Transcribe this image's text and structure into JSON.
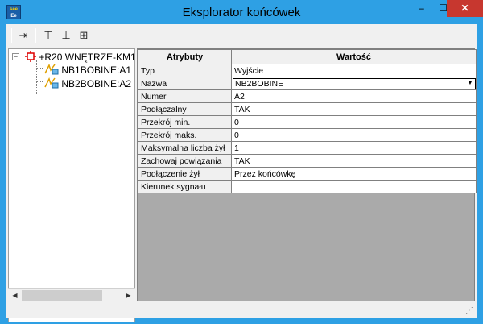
{
  "window": {
    "title": "Eksplorator końcówek",
    "icon": "app-icon",
    "icon_text_top": "see",
    "icon_text_bottom": "Ee",
    "controls": {
      "minimize": "‒",
      "maximize": "☐",
      "close": "✕"
    }
  },
  "toolbar": {
    "buttons": [
      {
        "name": "terminal-icon",
        "glyph": "⇥"
      },
      {
        "name": "connector-a-icon",
        "glyph": "⊤"
      },
      {
        "name": "connector-b-icon",
        "glyph": "⊥"
      },
      {
        "name": "connector-group-icon",
        "glyph": "⊞"
      }
    ]
  },
  "tree": {
    "root": {
      "label": "+R20 WNĘTRZE-KM1",
      "icon": "component-icon",
      "expander": "−"
    },
    "children": [
      {
        "label": "NB1BOBINE:A1",
        "icon": "coil-icon"
      },
      {
        "label": "NB2BOBINE:A2",
        "icon": "coil-icon"
      }
    ]
  },
  "grid": {
    "headers": {
      "attr": "Atrybuty",
      "value": "Wartość"
    },
    "rows": [
      {
        "attr": "Typ",
        "value": "Wyjście"
      },
      {
        "attr": "Nazwa",
        "value": "NB2BOBINE"
      },
      {
        "attr": "Numer",
        "value": "A2"
      },
      {
        "attr": "Podłączalny",
        "value": "TAK"
      },
      {
        "attr": "Przekrój min.",
        "value": "0"
      },
      {
        "attr": "Przekrój maks.",
        "value": "0"
      },
      {
        "attr": "Maksymalna liczba żył",
        "value": "1"
      },
      {
        "attr": "Zachowaj powiązania",
        "value": "TAK"
      },
      {
        "attr": "Podłączenie żył",
        "value": "Przez końcówkę"
      },
      {
        "attr": "Kierunek sygnału",
        "value": ""
      }
    ]
  },
  "colors": {
    "titlebar": "#2ea0e4",
    "close": "#c7372f",
    "grid_bg": "#aaaaaa"
  }
}
